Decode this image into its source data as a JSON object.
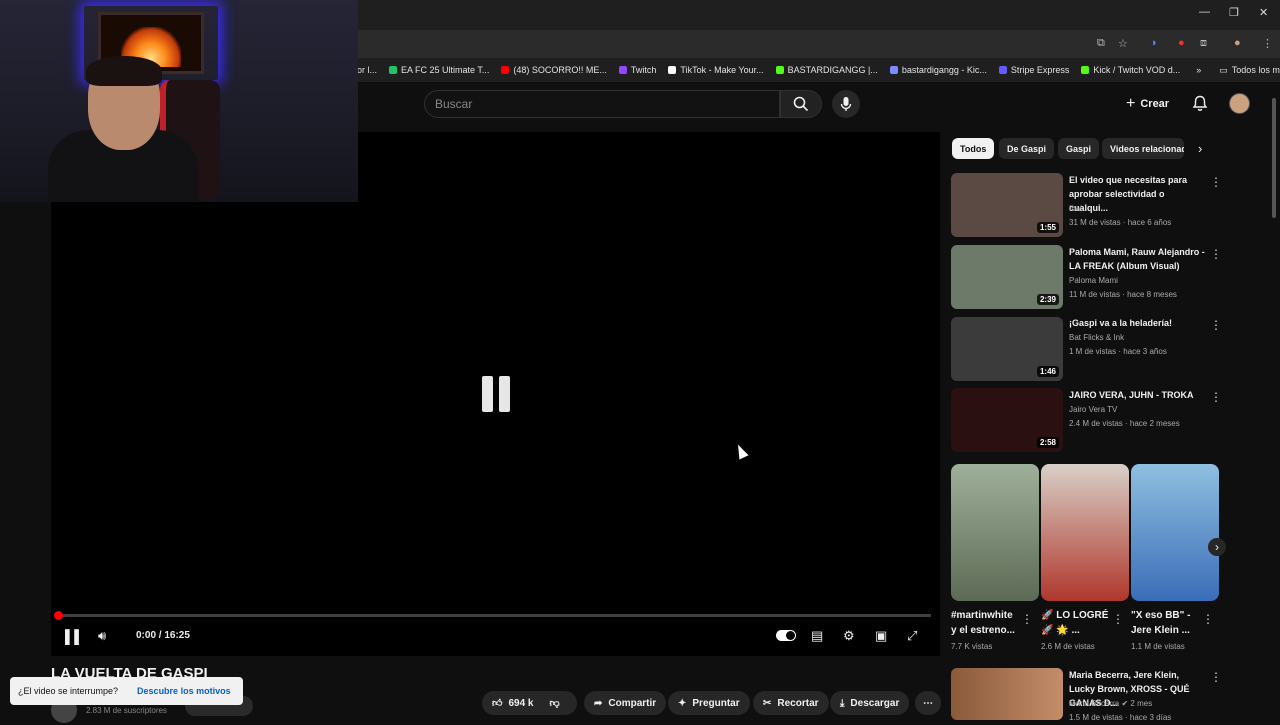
{
  "browser": {
    "bookmarks": [
      {
        "label": "idor l...",
        "color": "#5a5a5a"
      },
      {
        "label": "EA FC 25 Ultimate T...",
        "color": "#1ec26a"
      },
      {
        "label": "(48) SOCORRO!! ME...",
        "color": "#ff0000"
      },
      {
        "label": "Twitch",
        "color": "#9146ff"
      },
      {
        "label": "TikTok - Make Your...",
        "color": "#ffffff"
      },
      {
        "label": "BASTARDIGANGG |...",
        "color": "#53fc18"
      },
      {
        "label": "bastardigangg - Kic...",
        "color": "#7b8cff"
      },
      {
        "label": "Stripe Express",
        "color": "#635bff"
      },
      {
        "label": "Kick / Twitch VOD d...",
        "color": "#53fc18"
      }
    ],
    "all_bookmarks": "Todos los marcadores",
    "more": "»"
  },
  "header": {
    "search_placeholder": "Buscar",
    "create_label": "Crear"
  },
  "player": {
    "time": "0:00 / 16:25",
    "progress_fraction": 0.0
  },
  "video": {
    "title": "LA VUELTA DE GASPI",
    "subscribers": "2.83 M de suscriptores"
  },
  "toast": {
    "text": "¿El video se interrumpe?",
    "link": "Descubre los motivos"
  },
  "actions": {
    "likes": "694 k",
    "share": "Compartir",
    "ask": "Preguntar",
    "clip": "Recortar",
    "download": "Descargar"
  },
  "chips": [
    "Todos",
    "De Gaspi",
    "Gaspi",
    "Videos relacionad"
  ],
  "recommendations": [
    {
      "title": "El video que necesitas para aprobar selectividad o cualqui...",
      "channel": "Ibai",
      "meta": "31 M de vistas · hace 6 años",
      "duration": "1:55",
      "thumb": "#5b4a43"
    },
    {
      "title": "Paloma Mami, Rauw Alejandro - LA FREAK (Album Visual)",
      "channel": "Paloma Mami",
      "meta": "11 M de vistas · hace 8 meses",
      "duration": "2:39",
      "thumb": "#6d7a6a"
    },
    {
      "title": "¡Gaspi va a la heladería!",
      "channel": "Bat Flicks & Ink",
      "meta": "1 M de vistas · hace 3 años",
      "duration": "1:46",
      "thumb": "#3b3b3b"
    },
    {
      "title": "JAIRO VERA, JUHN - TROKA",
      "channel": "Jairo Vera TV",
      "meta": "2.4 M de vistas · hace 2 meses",
      "duration": "2:58",
      "thumb": "#2a1010"
    }
  ],
  "shorts": [
    {
      "title": "#martinwhite y el estreno...",
      "views": "7.7 K vistas",
      "thumb": "#7a8a70"
    },
    {
      "title": "🚀 LO LOGRÉ 🚀 🌟 ...",
      "views": "2.6 M de vistas",
      "thumb": "#b0372c"
    },
    {
      "title": "\"X eso BB\" - Jere Klein ...",
      "views": "1.1 M de vistas",
      "thumb": "#3a6db8"
    }
  ],
  "last_rec": {
    "title": "Maria Becerra, Jere Klein, Lucky Brown, XROSS - QUÉ GANAS D...",
    "channel": "Maria Becerra",
    "meta": "1.5 M de vistas · hace 3 días",
    "extra": "2 mes"
  }
}
